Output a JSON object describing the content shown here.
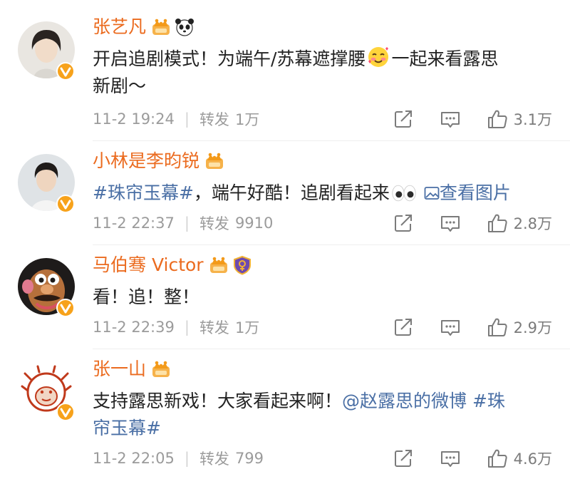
{
  "comments": [
    {
      "username": "张艺凡",
      "text_parts": [
        "开启追剧模式！为端午/苏幕遮撑腰",
        "一起来看露思",
        "新剧～"
      ],
      "date": "11-2 19:24",
      "repost_label": "转发",
      "repost_count": "1万",
      "likes": "3.1万"
    },
    {
      "username": "小林是李昀锐",
      "hashtag": "#珠帘玉幕#",
      "text_parts": [
        "，端午好酷！追剧看起来"
      ],
      "image_link": "查看图片",
      "date": "11-2 22:37",
      "repost_label": "转发",
      "repost_count": "9910",
      "likes": "2.8万"
    },
    {
      "username": "马伯骞 Victor",
      "text_parts": [
        "看！追！整！"
      ],
      "date": "11-2 22:39",
      "repost_label": "转发",
      "repost_count": "1万",
      "likes": "2.9万"
    },
    {
      "username": "张一山",
      "text_parts": [
        "支持露思新戏！大家看起来啊！"
      ],
      "mention": "@赵露思的微博",
      "hashtag_a": "#珠",
      "hashtag_b": "帘玉幕#",
      "date": "11-2 22:05",
      "repost_label": "转发",
      "repost_count": "799",
      "likes": "4.6万"
    }
  ],
  "colors": {
    "username": "#eb6b1f",
    "link": "#4a6fa5",
    "meta": "#9b9b9b",
    "badge": "#f7a21b"
  },
  "icons": [
    "crown-icon",
    "panda-icon",
    "shield-badge-icon",
    "share-icon",
    "comment-icon",
    "like-icon",
    "verified-icon",
    "image-icon"
  ]
}
